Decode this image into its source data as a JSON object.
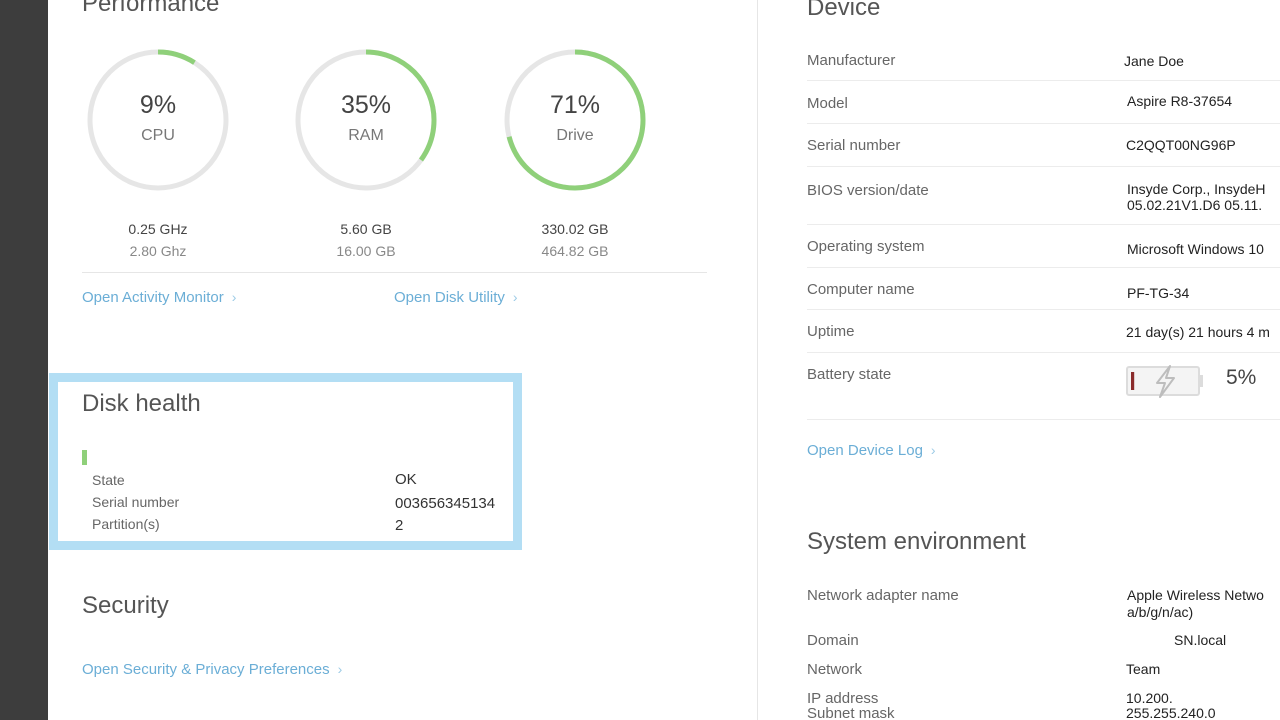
{
  "colors": {
    "accent_link": "#6baed6",
    "gauge_fill": "#8fd07a",
    "gauge_track": "#e6e6e6",
    "highlight_border": "#b3def4",
    "battery_low": "#8b2c2c"
  },
  "performance": {
    "title": "Performance",
    "gauges": [
      {
        "percent_value": 9,
        "percent_text": "9%",
        "label": "CPU",
        "value_line1": "0.25 GHz",
        "value_line2": "2.80 Ghz"
      },
      {
        "percent_value": 35,
        "percent_text": "35%",
        "label": "RAM",
        "value_line1": "5.60 GB",
        "value_line2": "16.00 GB"
      },
      {
        "percent_value": 71,
        "percent_text": "71%",
        "label": "Drive",
        "value_line1": "330.02 GB",
        "value_line2": "464.82 GB"
      }
    ],
    "links": {
      "activity_monitor": "Open Activity Monitor",
      "disk_utility": "Open Disk Utility"
    }
  },
  "disk_health": {
    "title": "Disk health",
    "rows": [
      {
        "label": "State",
        "value": "OK"
      },
      {
        "label": "Serial number",
        "value": "003656345134"
      },
      {
        "label": "Partition(s)",
        "value": "2"
      }
    ]
  },
  "security": {
    "title": "Security",
    "link": "Open Security & Privacy Preferences"
  },
  "device": {
    "title": "Device",
    "rows": [
      {
        "label": "Manufacturer",
        "value": "Jane Doe"
      },
      {
        "label": "Model",
        "value": "Aspire R8-37654"
      },
      {
        "label": "Serial number",
        "value": "C2QQT00NG96P"
      },
      {
        "label": "BIOS version/date",
        "value": "Insyde Corp., InsydeH",
        "value2": "05.02.21V1.D6 05.11."
      },
      {
        "label": "Operating system",
        "value": "Microsoft Windows 10"
      },
      {
        "label": "Computer name",
        "value": "PF-TG-34"
      },
      {
        "label": "Uptime",
        "value": "21 day(s) 21 hours 4 m"
      },
      {
        "label": "Battery state",
        "value": "5%"
      }
    ],
    "battery_percent": 5,
    "link": "Open Device Log"
  },
  "system_environment": {
    "title": "System environment",
    "rows": [
      {
        "label": "Network adapter name",
        "value": "Apple Wireless Netwo",
        "value2": "a/b/g/n/ac)"
      },
      {
        "label": "Domain",
        "value": "SN.local"
      },
      {
        "label": "Network",
        "value": "Team"
      },
      {
        "label": "IP address",
        "value": "10.200."
      },
      {
        "label": "Subnet mask",
        "value": "255.255.240.0"
      }
    ]
  }
}
